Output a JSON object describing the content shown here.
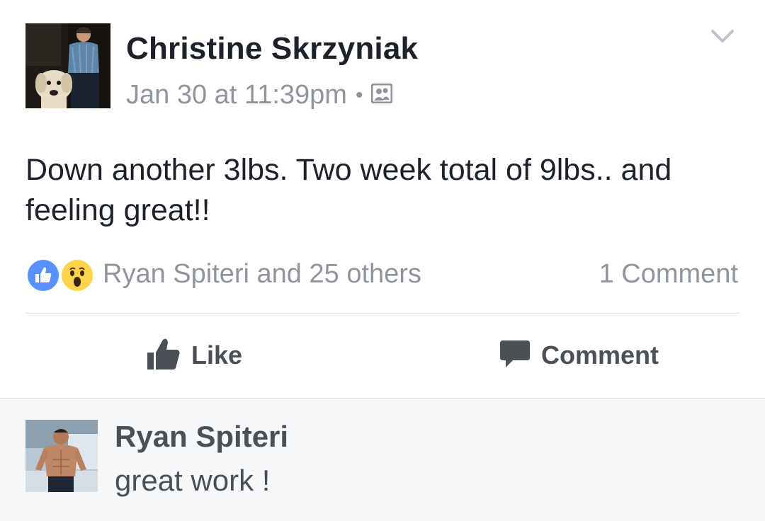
{
  "post": {
    "author": "Christine Skrzyniak",
    "date": "Jan 30 at 11:39pm",
    "separator": "•",
    "privacy_icon": "friends-icon",
    "text": "Down another 3lbs. Two week total of 9lbs.. and feeling great!!",
    "reaction_icons": [
      "like-reaction-icon",
      "wow-reaction-icon"
    ],
    "reactors": "Ryan Spiteri and 25 others",
    "comment_count": "1 Comment"
  },
  "actions": {
    "like_label": "Like",
    "comment_label": "Comment"
  },
  "comments": [
    {
      "author": "Ryan Spiteri",
      "text": "great work !"
    }
  ],
  "colors": {
    "primary_text": "#1d2129",
    "secondary_text": "#90949c",
    "action_text": "#4b4f56",
    "like_blue": "#5890ff",
    "wow_yellow": "#fcd34a",
    "comments_bg": "#f6f7f9"
  }
}
